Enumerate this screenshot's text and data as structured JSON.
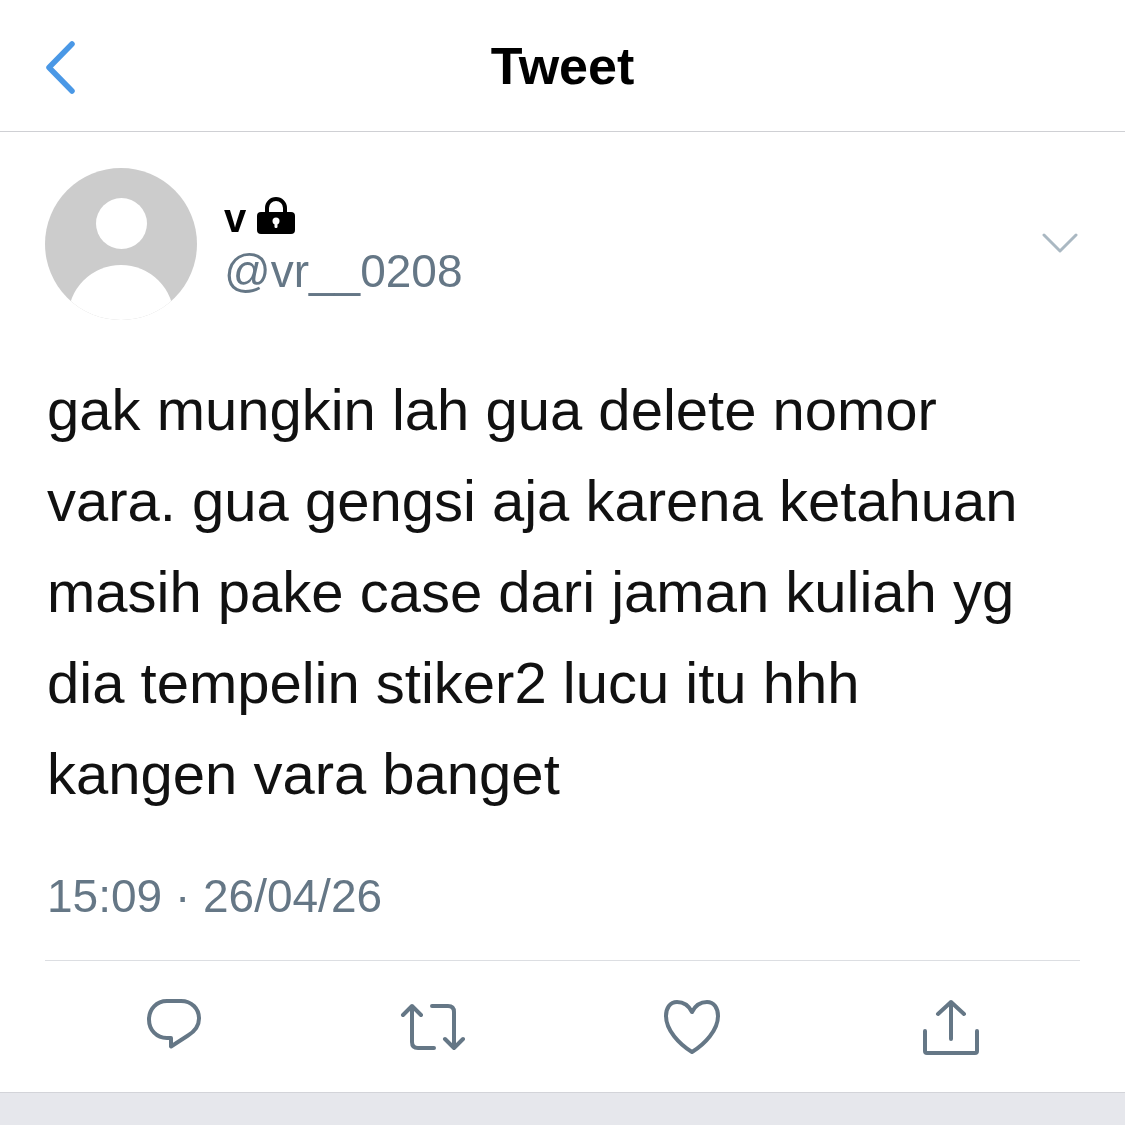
{
  "header": {
    "title": "Tweet"
  },
  "tweet": {
    "author": {
      "name": "v",
      "protected": true,
      "handle": "@vr__0208"
    },
    "text": "gak mungkin lah gua delete nomor\nvara. gua gengsi aja karena ketahuan\nmasih pake case dari jaman kuliah yg\ndia tempelin stiker2 lucu itu hhh\nkangen vara banget",
    "timestamp": "15:09 · 26/04/26"
  }
}
